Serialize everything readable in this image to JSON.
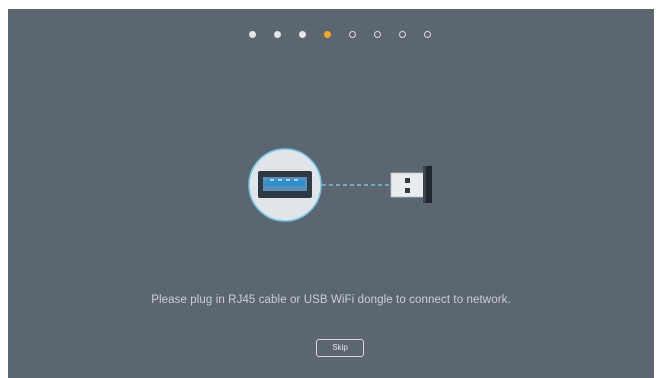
{
  "wizard": {
    "steps_total": 8,
    "current_step": 4,
    "message": "Please plug in RJ45 cable or USB WiFi dongle to connect to network.",
    "skip_label": "Skip"
  },
  "colors": {
    "background": "#5b6670",
    "dot_current": "#f5a623",
    "dot_done": "#e3e6e9",
    "port_circle": "#dfe5e8",
    "port_ring": "#76c7e6",
    "usb_port_insert": "#2e90d1"
  },
  "icons": {
    "port": "usb-port-icon",
    "dongle": "usb-dongle-icon",
    "connector": "dashed-connection-line"
  }
}
